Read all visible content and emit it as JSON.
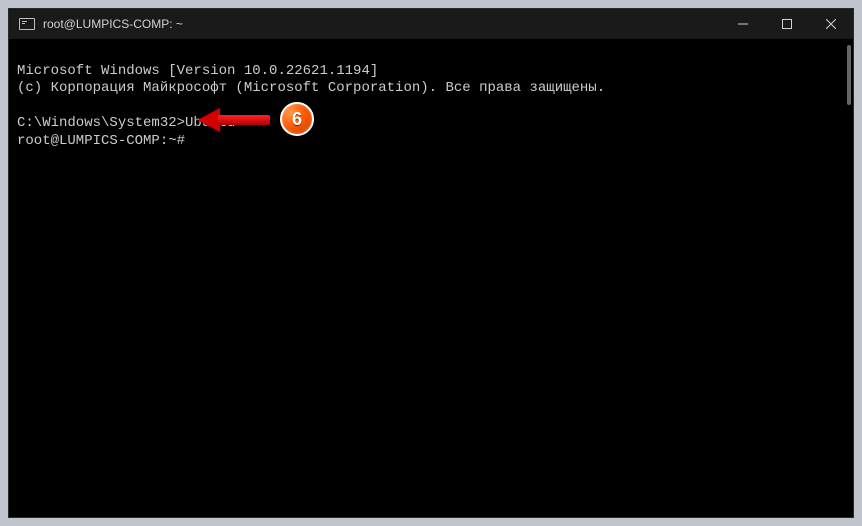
{
  "window": {
    "title": "root@LUMPICS-COMP: ~"
  },
  "terminal": {
    "line1": "Microsoft Windows [Version 10.0.22621.1194]",
    "line2": "(c) Корпорация Майкрософт (Microsoft Corporation). Все права защищены.",
    "blank1": "",
    "prompt1": "C:\\Windows\\System32>",
    "command1": "Ubuntu",
    "prompt2": "root@LUMPICS-COMP:~#",
    "cursor": " "
  },
  "annotation": {
    "step_number": "6"
  }
}
